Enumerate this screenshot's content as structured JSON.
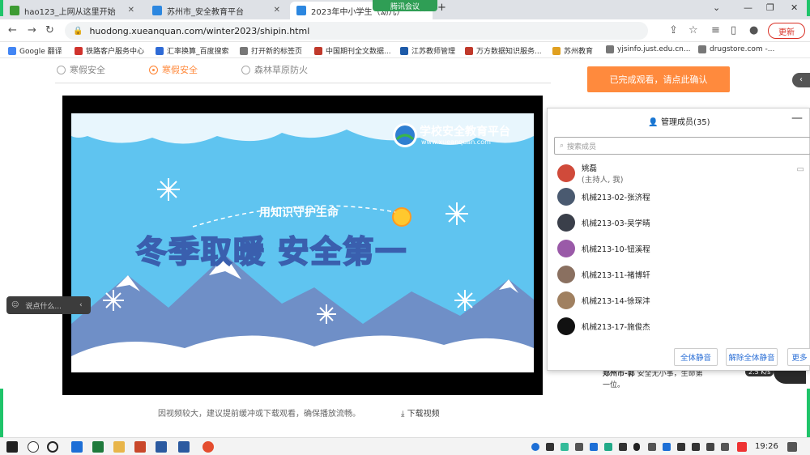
{
  "browser": {
    "tabs": [
      {
        "title": "hao123_上网从这里开始",
        "color": "#3d9b33"
      },
      {
        "title": "苏州市_安全教育平台",
        "color": "#2c87e0"
      },
      {
        "title": "2023年中小学生（幼儿）",
        "color": "#2c87e0"
      }
    ],
    "new_tab_glyph": "+",
    "url": "huodong.xueanquan.com/winter2023/shipin.html",
    "update_label": "更新",
    "meeting_pill": "腾讯会议"
  },
  "bookmarks": [
    {
      "label": "Google 翻译",
      "color": "#4285f4"
    },
    {
      "label": "铁路客户服务中心",
      "color": "#d0332d"
    },
    {
      "label": "汇率换算_百度搜索",
      "color": "#2f6bd6"
    },
    {
      "label": "打开新的标签页",
      "color": "#777777"
    },
    {
      "label": "中国期刊全文数据...",
      "color": "#c0392b"
    },
    {
      "label": "江苏教师管理",
      "color": "#1d5aa8"
    },
    {
      "label": "万方数据知识服务...",
      "color": "#c0392b"
    },
    {
      "label": "苏州教育",
      "color": "#e0a020"
    },
    {
      "label": "yjsinfo.just.edu.cn...",
      "color": "#777777"
    },
    {
      "label": "drugstore.com -...",
      "color": "#777777"
    }
  ],
  "page": {
    "radios": [
      {
        "label": "寒假安全",
        "selected": false
      },
      {
        "label": "寒假安全",
        "selected": true
      },
      {
        "label": "森林草原防火",
        "selected": false
      }
    ],
    "confirm_label": "已完成观看，请点此确认",
    "video": {
      "brand": "学校安全教育平台",
      "brand_url": "www.xueanquan.com",
      "subtitle": "用知识守护生命",
      "headline": "冬季取暖 安全第一"
    },
    "notice": "因视频较大，建议提前缓冲或下载观看，确保播放流畅。",
    "download_label": "下载视频",
    "side_text_1": "郑州市-郭",
    "side_text_2": "安全无小事，生命第一位。",
    "chat_placeholder": "说点什么..."
  },
  "meeting": {
    "title": "管理成员(35)",
    "search_placeholder": "搜索成员",
    "host": {
      "name": "姚磊",
      "role": "(主持人, 我)"
    },
    "members": [
      {
        "name": "机械213-02-张济程"
      },
      {
        "name": "机械213-03-吴学晴"
      },
      {
        "name": "机械213-10-钮溪程"
      },
      {
        "name": "机械213-11-褚博轩"
      },
      {
        "name": "机械213-14-徐琛沣"
      },
      {
        "name": "机械213-17-施俊杰"
      }
    ],
    "buttons": {
      "mute_all": "全体静音",
      "unmute_all": "解除全体静音",
      "more": "更多"
    },
    "speed": "2.5 K/s"
  },
  "taskbar": {
    "time": "19:26"
  }
}
